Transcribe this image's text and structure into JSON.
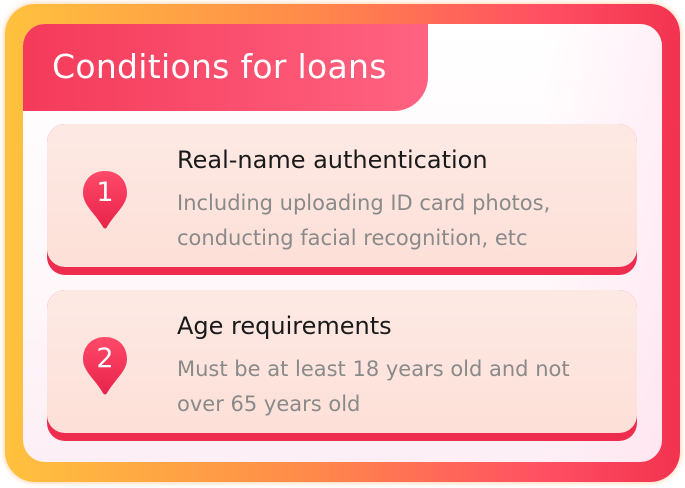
{
  "title": "Conditions for loans",
  "conditions": [
    {
      "number": "1",
      "heading": "Real-name authentication",
      "description": "Including uploading ID card photos, conducting facial recognition, etc"
    },
    {
      "number": "2",
      "heading": "Age requirements",
      "description": "Must be at least 18 years old and not over 65 years old"
    }
  ],
  "colors": {
    "accent": "#f53a5a",
    "frame_gradient": [
      "#ffc23e",
      "#ff8a4a",
      "#ff4f63",
      "#f2334f"
    ],
    "item_background": "#fde5de",
    "heading_text": "#1a1a1a",
    "description_text": "#8a8a8a"
  },
  "icons": {
    "number_marker": "map-pin-icon"
  }
}
